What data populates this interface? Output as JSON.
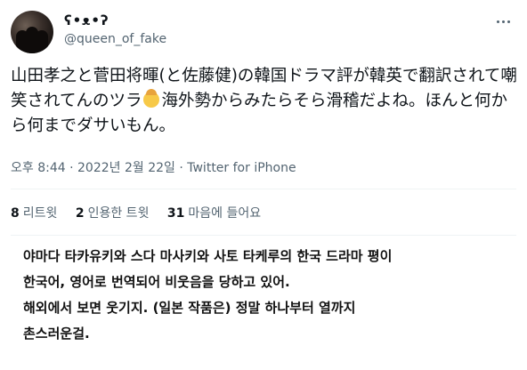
{
  "tweet": {
    "display_name": "ʕ•ᴥ•ʔ",
    "handle": "@queen_of_fake",
    "text_parts": [
      "山田孝之と菅田将暉(と佐藤健)の韓国ドラマ評が韓英で翻訳されて嘲笑されてんのツラ",
      "海外勢からみたらそら滑稽だよね。ほんと何から何までダサいもん。"
    ],
    "emoji": "facepalm-emoji",
    "timestamp": "오후 8:44 · 2022년 2월 22일",
    "source": "Twitter for iPhone"
  },
  "stats": [
    {
      "count": "8",
      "label": "리트윗"
    },
    {
      "count": "2",
      "label": "인용한 트윗"
    },
    {
      "count": "31",
      "label": "마음에 들어요"
    }
  ],
  "translation": {
    "lines": [
      "야마다 타카유키와 스다 마사키와 사토 타케루의 한국 드라마 평이",
      "한국어, 영어로 번역되어 비웃음을 당하고 있어.",
      "해외에서 보면 웃기지. (일본 작품은) 정말 하나부터 열까지",
      "촌스러운걸."
    ]
  }
}
